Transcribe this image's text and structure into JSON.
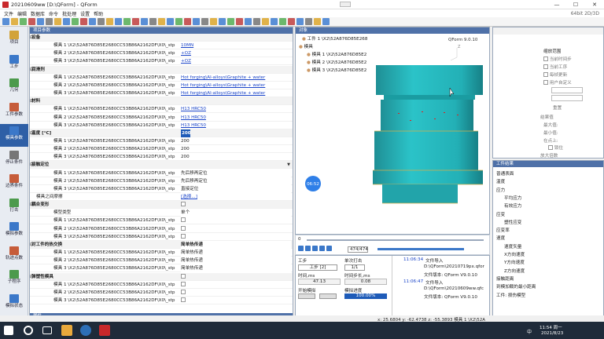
{
  "window": {
    "title": "20210609ww  [D:\\QForm] - QForm",
    "min": "—",
    "max": "☐",
    "close": "✕"
  },
  "menu": {
    "items": [
      "文件",
      "编辑",
      "数据库",
      "命令",
      "批处理",
      "设置",
      "帮助"
    ],
    "version": "64bit 2D/3D"
  },
  "nav": {
    "items": [
      "项目",
      "工步",
      "几何",
      "工件参数",
      "模具参数",
      "停止条件",
      "边界条件",
      "打击",
      "模拟参数",
      "轨迹点数",
      "子程序",
      "模拟状态"
    ]
  },
  "prop": {
    "header": "项目参数",
    "footer": "属性",
    "rows": [
      {
        "type": "cat",
        "label": "设备",
        "value": ""
      },
      {
        "type": "item",
        "label": "模具 1 \\X2\\52A876D85E2680CC53B86A2162DF\\X0\\_stp",
        "value": "10MN",
        "vtype": "link"
      },
      {
        "type": "item",
        "label": "模具 2 \\X2\\52A876D85E2680CC53B86A2162DF\\X0\\_stp",
        "value": "+OZ",
        "vtype": "link"
      },
      {
        "type": "item",
        "label": "模具 3 \\X2\\52A876D85E2680CC53B86A2162DF\\X0\\_stp",
        "value": "+OZ",
        "vtype": "link"
      },
      {
        "type": "cat",
        "label": "润滑剂",
        "value": ""
      },
      {
        "type": "item",
        "label": "模具 1 \\X2\\52A876D85E2680CC53B86A2162DF\\X0\\_stp",
        "value": "Hot forging\\Al-alloys\\Graphite + water",
        "vtype": "link"
      },
      {
        "type": "item",
        "label": "模具 2 \\X2\\52A876D85E2680CC53B86A2162DF\\X0\\_stp",
        "value": "Hot forging\\Al-alloys\\Graphite + water",
        "vtype": "link"
      },
      {
        "type": "item",
        "label": "模具 3 \\X2\\52A876D85E2680CC53B86A2162DF\\X0\\_stp",
        "value": "Hot forging\\Al-alloys\\Graphite + water",
        "vtype": "link"
      },
      {
        "type": "cat",
        "label": "材料",
        "value": ""
      },
      {
        "type": "item",
        "label": "模具 1 \\X2\\52A876D85E2680CC53B86A2162DF\\X0\\_stp",
        "value": "H13 HRC50",
        "vtype": "link"
      },
      {
        "type": "item",
        "label": "模具 2 \\X2\\52A876D85E2680CC53B86A2162DF\\X0\\_stp",
        "value": "H13 HRC50",
        "vtype": "link"
      },
      {
        "type": "item",
        "label": "模具 3 \\X2\\52A876D85E2680CC53B86A2162DF\\X0\\_stp",
        "value": "H13 HRC50",
        "vtype": "link"
      },
      {
        "type": "cat",
        "label": "温度 [°C]",
        "value": "200",
        "vtype": "sel"
      },
      {
        "type": "item",
        "label": "模具 1 \\X2\\52A876D85E2680CC53B86A2162DF\\X0\\_stp",
        "value": "200",
        "vtype": "text"
      },
      {
        "type": "item",
        "label": "模具 2 \\X2\\52A876D85E2680CC53B86A2162DF\\X0\\_stp",
        "value": "200",
        "vtype": "text"
      },
      {
        "type": "item",
        "label": "模具 3 \\X2\\52A876D85E2680CC53B86A2162DF\\X0\\_stp",
        "value": "200",
        "vtype": "text"
      },
      {
        "type": "cat",
        "label": "接触定位",
        "value": "",
        "vtype": "combo"
      },
      {
        "type": "item",
        "label": "模具 1 \\X2\\52A876D85E2680CC53B86A2162DF\\X0\\_stp",
        "value": "先后移再定位",
        "vtype": "combo"
      },
      {
        "type": "item",
        "label": "模具 2 \\X2\\52A876D85E2680CC53B86A2162DF\\X0\\_stp",
        "value": "先后移再定位",
        "vtype": "combo"
      },
      {
        "type": "item",
        "label": "模具 3 \\X2\\52A876D85E2680CC53B86A2162DF\\X0\\_stp",
        "value": "直接定位",
        "vtype": "combo"
      },
      {
        "type": "item2",
        "label": "模具之间摩擦",
        "value": "[选择...]",
        "vtype": "link"
      },
      {
        "type": "cat",
        "label": "耦合变形",
        "value": "",
        "vtype": "check"
      },
      {
        "type": "item",
        "label": "模型类型",
        "value": "单个",
        "vtype": "combo"
      },
      {
        "type": "item",
        "label": "模具 1 \\X2\\52A876D85E2680CC53B86A2162DF\\X0\\_stp",
        "value": "",
        "vtype": "check"
      },
      {
        "type": "item",
        "label": "模具 2 \\X2\\52A876D85E2680CC53B86A2162DF\\X0\\_stp",
        "value": "",
        "vtype": "check"
      },
      {
        "type": "item",
        "label": "模具 3 \\X2\\52A876D85E2680CC53B86A2162DF\\X0\\_stp",
        "value": "",
        "vtype": "check"
      },
      {
        "type": "cat",
        "label": "对工件的热交换",
        "value": "简单热传递",
        "vtype": "combo"
      },
      {
        "type": "item",
        "label": "模具 1 \\X2\\52A876D85E2680CC53B86A2162DF\\X0\\_stp",
        "value": "简单热传递",
        "vtype": "combo"
      },
      {
        "type": "item",
        "label": "模具 2 \\X2\\52A876D85E2680CC53B86A2162DF\\X0\\_stp",
        "value": "简单热传递",
        "vtype": "combo"
      },
      {
        "type": "item",
        "label": "模具 3 \\X2\\52A876D85E2680CC53B86A2162DF\\X0\\_stp",
        "value": "简单热传递",
        "vtype": "combo"
      },
      {
        "type": "cat",
        "label": "弹塑性模具",
        "value": "",
        "vtype": "check"
      },
      {
        "type": "item",
        "label": "模具 1 \\X2\\52A876D85E2680CC53B86A2162DF\\X0\\_stp",
        "value": "",
        "vtype": "check"
      },
      {
        "type": "item",
        "label": "模具 2 \\X2\\52A876D85E2680CC53B86A2162DF\\X0\\_stp",
        "value": "",
        "vtype": "check"
      },
      {
        "type": "item",
        "label": "模具 3 \\X2\\52A876D85E2680CC53B86A2162DF\\X0\\_stp",
        "value": "",
        "vtype": "check"
      }
    ]
  },
  "objects": {
    "header": "对象",
    "nodes": [
      "工件 1 \\X2\\52A876D85E268",
      "模具",
      "模具 1 \\X2\\52A876D85E2",
      "模具 2 \\X2\\52A876D85E2",
      "模具 3 \\X2\\52A876D85E2"
    ],
    "version": "QForm 9.0.10",
    "timer": "06:52",
    "axis": "Z"
  },
  "timeline": {
    "start": "0",
    "frame": "474/474",
    "tabs": [
      "工步",
      "单次打击"
    ],
    "step_label": "工步 [2]",
    "blow": "1/1",
    "time_label": "时间,ms",
    "time_value": "47.13",
    "step_time_label": "时间步长,ms",
    "step_time_value": "0.08",
    "start_label": "开始模拟",
    "progress_label": "模拟进度",
    "progress_value": "100.00%"
  },
  "log": {
    "entries": [
      {
        "time": "11:06:34",
        "event": "文件导入",
        "path": "D:\\QForm\\20210719px.qfor",
        "ver": "文件版本: QForm V9.0.10"
      },
      {
        "time": "11:06:47",
        "event": "文件导入",
        "path": "D:\\QForm\\20210609ww.qfc",
        "ver": "文件版本: QForm V9.0.10"
      }
    ]
  },
  "display": {
    "title": "缩放范围",
    "options": [
      "当前时间步",
      "当前工序",
      "每帧更新",
      "用户自定义"
    ],
    "reset": "重置",
    "results": "结果值",
    "stats": [
      "最大值:",
      "最小值:",
      "在点上:"
    ],
    "lock": "锁住",
    "zoom": "放大倍数"
  },
  "fields": {
    "header": "工件结果",
    "items": [
      "普通表面",
      "温度",
      "应力",
      "平均应力",
      "有效应力",
      "应变",
      "塑性应变",
      "应变率",
      "速度",
      "速度矢量",
      "X方向速度",
      "Y方向速度",
      "Z方向速度",
      "接触距离",
      "到模加载的最小距离",
      "工件: 损伤模型"
    ]
  },
  "status": {
    "coords": "x: 25.6804    y: -62.4738    z: -55.3893    模具 1 \\X2\\52A"
  },
  "taskbar": {
    "time": "11:54 周一",
    "date": "2021/8/23",
    "lang": "中"
  }
}
